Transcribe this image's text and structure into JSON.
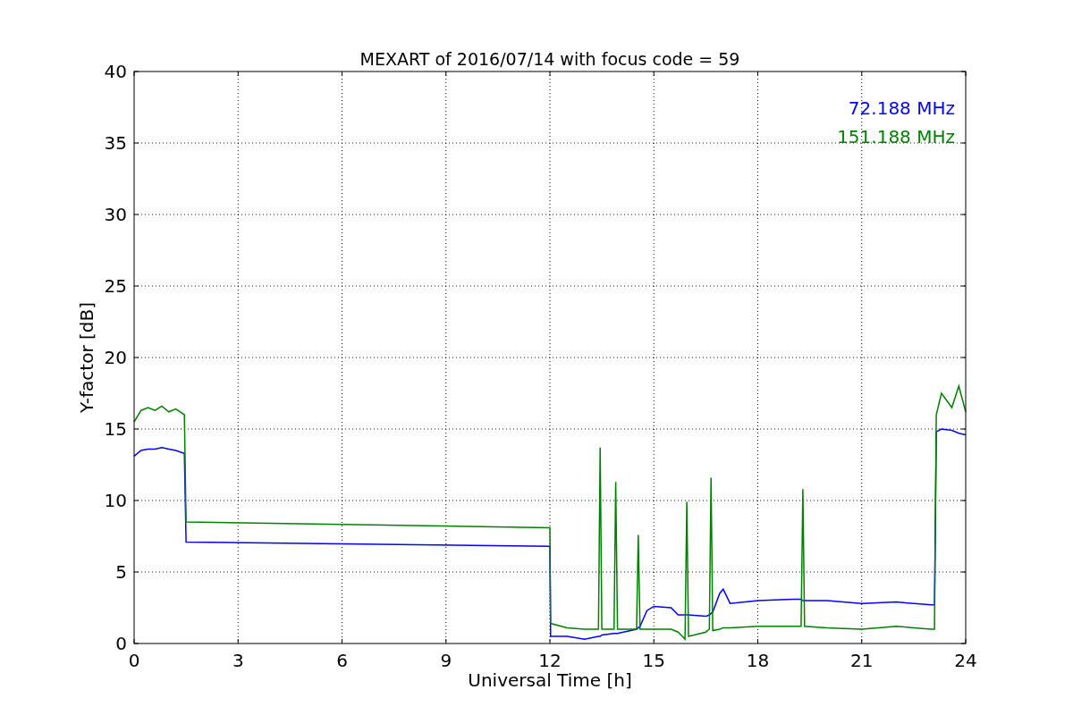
{
  "chart_data": {
    "type": "line",
    "title": "MEXART of 2016/07/14 with focus code = 59",
    "xlabel": "Universal Time [h]",
    "ylabel": "Y-factor [dB]",
    "x": [
      0,
      0.2,
      0.4,
      0.6,
      0.8,
      1.0,
      1.2,
      1.45,
      1.5,
      12,
      12.02,
      12.5,
      13,
      13.4,
      13.45,
      13.5,
      13.85,
      13.9,
      13.95,
      14.5,
      14.55,
      14.6,
      14.8,
      15,
      15.5,
      15.7,
      15.9,
      15.95,
      16,
      16.5,
      16.6,
      16.65,
      16.7,
      16.9,
      17,
      17.2,
      18,
      19,
      19.25,
      19.3,
      19.35,
      20,
      21,
      22,
      23,
      23.1,
      23.15,
      23.3,
      23.6,
      23.8,
      24
    ],
    "series": [
      {
        "name": "72.188 MHz",
        "color": "#0000ff",
        "values": [
          13.1,
          13.5,
          13.6,
          13.6,
          13.7,
          13.6,
          13.5,
          13.3,
          7.1,
          6.8,
          0.5,
          0.5,
          0.3,
          0.5,
          0.5,
          0.6,
          0.7,
          0.7,
          0.7,
          1.0,
          1.1,
          1.2,
          2.3,
          2.6,
          2.5,
          2.0,
          2.0,
          2.0,
          2.0,
          1.9,
          2.0,
          2.1,
          2.2,
          3.5,
          3.8,
          2.8,
          3.0,
          3.1,
          3.1,
          3.0,
          3.0,
          3.0,
          2.8,
          2.9,
          2.7,
          2.7,
          14.8,
          15.0,
          14.9,
          14.7,
          14.6
        ]
      },
      {
        "name": "151.188 MHz",
        "color": "#008000",
        "values": [
          15.5,
          16.3,
          16.5,
          16.3,
          16.6,
          16.2,
          16.4,
          16.0,
          8.5,
          8.1,
          1.4,
          1.1,
          1.0,
          1.0,
          13.7,
          1.0,
          1.0,
          11.3,
          1.0,
          1.0,
          7.6,
          1.0,
          1.0,
          1.0,
          1.0,
          0.8,
          0.3,
          9.9,
          0.5,
          0.8,
          1.0,
          11.6,
          0.9,
          1.0,
          1.1,
          1.1,
          1.2,
          1.2,
          1.2,
          10.8,
          1.2,
          1.1,
          1.0,
          1.2,
          1.0,
          1.0,
          16.0,
          17.5,
          16.5,
          18.0,
          16.2
        ]
      }
    ],
    "grid": true,
    "xlim": [
      0,
      24
    ],
    "ylim": [
      0,
      40
    ],
    "xticks": [
      0,
      3,
      6,
      9,
      12,
      15,
      18,
      21,
      24
    ],
    "yticks": [
      0,
      5,
      10,
      15,
      20,
      25,
      30,
      35,
      40
    ]
  }
}
